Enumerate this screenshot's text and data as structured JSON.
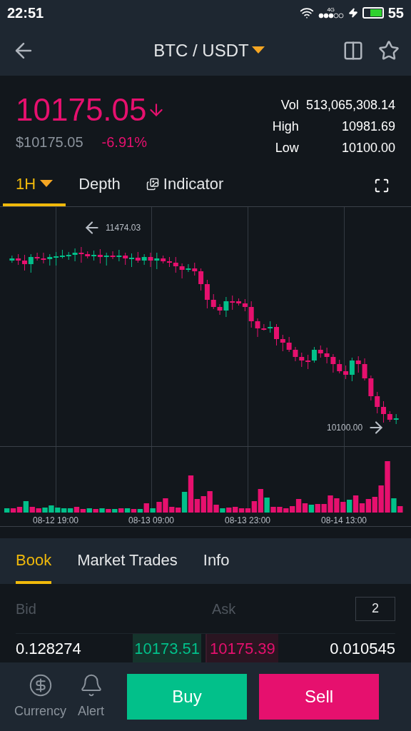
{
  "status_bar": {
    "time": "22:51",
    "network": "4G",
    "battery": "55"
  },
  "header": {
    "pair": "BTC / USDT"
  },
  "ticker": {
    "price": "10175.05",
    "falling": true,
    "fiat_price": "$10175.05",
    "change": "-6.91%",
    "stats": [
      {
        "label": "Vol",
        "value": "513,065,308.14"
      },
      {
        "label": "High",
        "value": "10981.69"
      },
      {
        "label": "Low",
        "value": "10100.00"
      }
    ]
  },
  "chart_tabs": [
    {
      "label": "1H",
      "selected": true,
      "kind": "dropdown"
    },
    {
      "label": "Depth",
      "selected": false,
      "kind": "plain"
    },
    {
      "label": "Indicator",
      "selected": false,
      "kind": "icon"
    }
  ],
  "chart": {
    "high_marker": "11474.03",
    "low_marker": "10100.00",
    "time_labels": [
      "08-12 19:00",
      "08-13 09:00",
      "08-13 23:00",
      "08-14 13:00"
    ]
  },
  "book_tabs": [
    {
      "label": "Book",
      "selected": true
    },
    {
      "label": "Market Trades",
      "selected": false
    },
    {
      "label": "Info",
      "selected": false
    }
  ],
  "order_book": {
    "bid_header": "Bid",
    "ask_header": "Ask",
    "precision": "2",
    "rows": [
      {
        "bid_amount": "0.128274",
        "bid_price": "10173.51",
        "ask_price": "10175.39",
        "ask_amount": "0.010545"
      }
    ]
  },
  "bottom_bar": {
    "actions": [
      {
        "label": "Currency",
        "kind": "currency"
      },
      {
        "label": "Alert",
        "kind": "alert"
      }
    ],
    "buy": "Buy",
    "sell": "Sell"
  }
}
